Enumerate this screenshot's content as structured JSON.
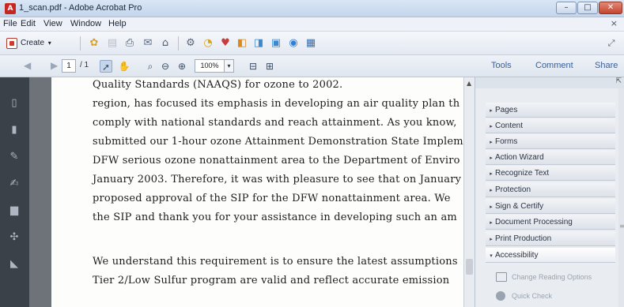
{
  "window": {
    "title": "1_scan.pdf - Adobe Acrobat Pro",
    "app_icon": "acrobat-icon",
    "controls": {
      "minimize": "–",
      "maximize": "□",
      "close": "✕"
    }
  },
  "menubar": {
    "items": [
      "File",
      "Edit",
      "View",
      "Window",
      "Help"
    ],
    "close_glyph": "×"
  },
  "toolbar": {
    "create_label": "Create",
    "create_arrow": "▾",
    "icons": [
      "combine-icon",
      "open-icon",
      "print-icon",
      "email-icon",
      "share-icon",
      "settings-icon",
      "comment-icon",
      "stamp-icon",
      "export-icon",
      "convert-icon",
      "pages-icon",
      "security-icon",
      "forms-icon"
    ]
  },
  "navtoolbar": {
    "current_page": "1",
    "page_count": "/ 1",
    "zoom": "100%",
    "zoom_dropdown": "▾",
    "right_tabs": [
      "Tools",
      "Comment",
      "Share"
    ]
  },
  "document": {
    "lines": [
      "Quality Standards (NAAQS) for ozone to 2002.",
      "region, has focused its emphasis in developing an air quality plan th",
      "comply with national standards and reach attainment. As you know,",
      "submitted our 1-hour ozone Attainment Demonstration State Implem",
      "DFW serious ozone nonattainment area to the Department of Enviro",
      "January 2003. Therefore, it was with pleasure to see that on January",
      "proposed approval of the SIP for the DFW nonattainment area. We",
      "the SIP and thank you for your assistance in developing such an am",
      "We understand this requirement is to ensure the latest assumptions",
      "Tier 2/Low Sulfur program are valid and reflect accurate emission"
    ]
  },
  "tools_panel": {
    "panels": [
      {
        "label": "Pages"
      },
      {
        "label": "Content"
      },
      {
        "label": "Forms"
      },
      {
        "label": "Action Wizard"
      },
      {
        "label": "Recognize Text"
      },
      {
        "label": "Protection"
      },
      {
        "label": "Sign & Certify"
      },
      {
        "label": "Document Processing"
      },
      {
        "label": "Print Production"
      },
      {
        "label": "Accessibility"
      }
    ],
    "accessibility_items": [
      {
        "label": "Change Reading Options",
        "icon": "reading-options-icon"
      },
      {
        "label": "Quick Check",
        "icon": "quick-check-icon"
      }
    ]
  },
  "colors": {
    "titlebar": "#c4d6ec",
    "document_bg": "#6e737a",
    "left_pane": "#3b4149",
    "tab_link": "#3a5f96"
  }
}
